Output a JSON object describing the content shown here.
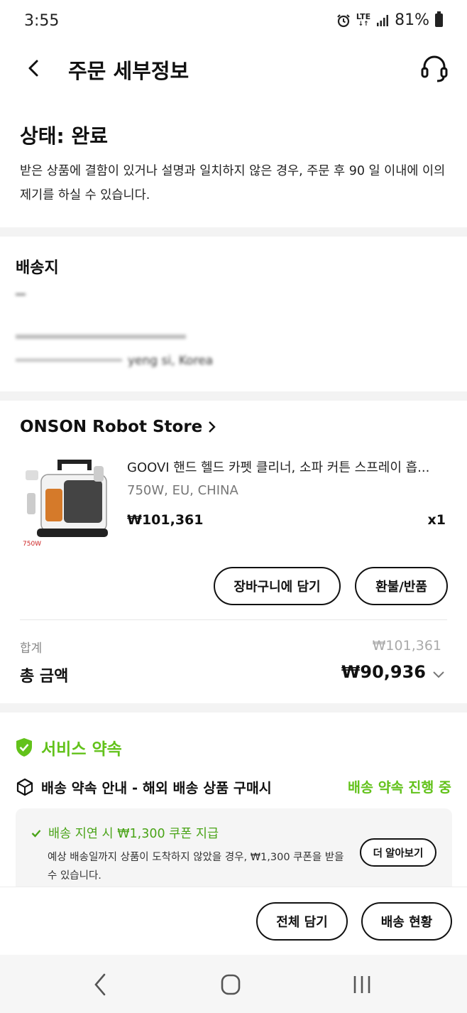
{
  "status_bar": {
    "time": "3:55",
    "network": "LTE",
    "battery": "81%",
    "icons": [
      "alarm-icon",
      "signal-icon",
      "battery-icon"
    ]
  },
  "header": {
    "title": "주문 세부정보",
    "back_icon": "chevron-left-icon",
    "support_icon": "headset-icon"
  },
  "order_status": {
    "heading": "상태: 완료",
    "description": "받은 상품에 결함이 있거나 설명과 일치하지 않은 경우, 주문 후 90 일 이내에 이의 제기를 하실 수 있습니다."
  },
  "shipping_address": {
    "title": "배송지",
    "line_fragment": "yeng si, Korea"
  },
  "order": {
    "store_name": "ONSON Robot Store",
    "product": {
      "name": "GOOVI 핸드 헬드 카펫 클리너, 소파 커튼 스프레이 흡...",
      "option": "750W, EU, CHINA",
      "price": "₩101,361",
      "quantity": "x1",
      "image_badge": "750W"
    },
    "add_to_cart_label": "장바구니에 담기",
    "refund_label": "환불/반품",
    "subtotal_label": "합계",
    "subtotal_value": "₩101,361",
    "total_label": "총 금액",
    "total_value": "₩90,936"
  },
  "service_promise": {
    "title": "서비스 약속",
    "promise_label": "배송 약속 안내 - 해외 배송 상품 구매시",
    "promise_status": "배송 약속 진행 중",
    "coupon_title": "배송 지연 시 ₩1,300 쿠폰 지급",
    "coupon_description": "예상 배송일까지 상품이 도착하지 않았을 경우, ₩1,300 쿠폰을 받을 수 있습니다.",
    "learn_more_label": "더 알아보기"
  },
  "bottom_actions": {
    "add_all_label": "전체 담기",
    "tracking_label": "배송 현황"
  },
  "colors": {
    "accent_green": "#62c21a",
    "divider_gray": "#f3f3f3"
  }
}
